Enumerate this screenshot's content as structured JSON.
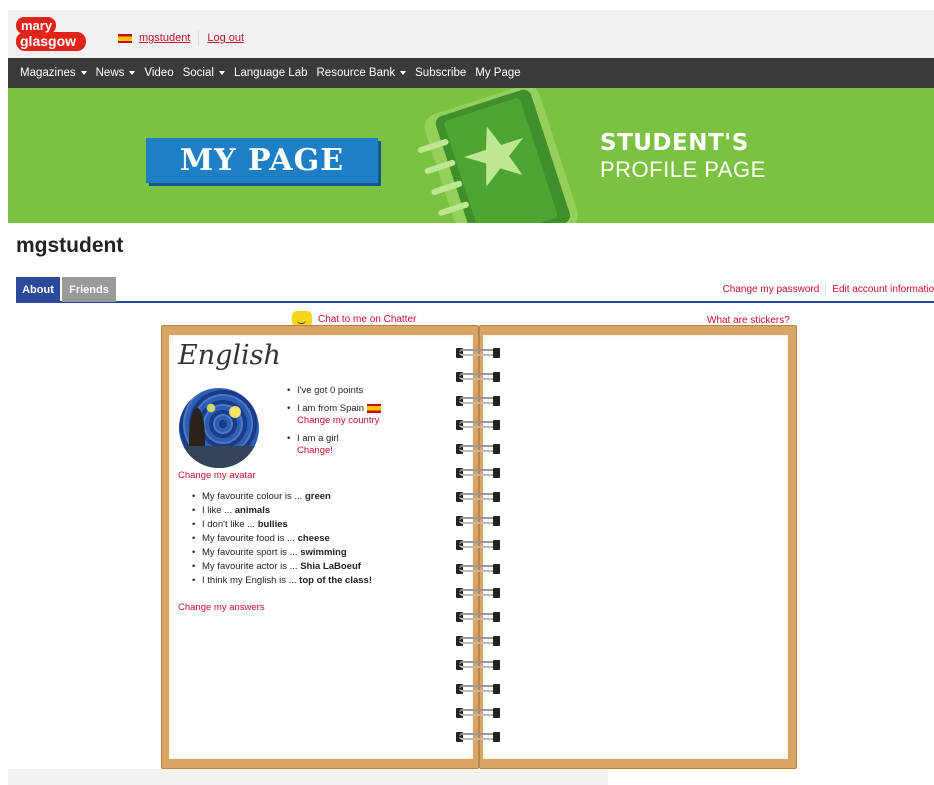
{
  "header": {
    "user_name": "mgstudent",
    "logout": "Log out"
  },
  "nav": {
    "items": [
      {
        "label": "Magazines",
        "dropdown": true
      },
      {
        "label": "News",
        "dropdown": true
      },
      {
        "label": "Video",
        "dropdown": false
      },
      {
        "label": "Social",
        "dropdown": true
      },
      {
        "label": "Language Lab",
        "dropdown": false
      },
      {
        "label": "Resource Bank",
        "dropdown": true
      },
      {
        "label": "Subscribe",
        "dropdown": false
      },
      {
        "label": "My Page",
        "dropdown": false
      }
    ]
  },
  "banner": {
    "badge": "MY PAGE",
    "title_line1": "STUDENT'S",
    "title_line2": "PROFILE PAGE"
  },
  "page_title": "mgstudent",
  "tabs": {
    "about": "About",
    "friends": "Friends",
    "change_password": "Change my password",
    "edit_account": "Edit account informatio"
  },
  "notebook": {
    "chatter_link": "Chat to me on Chatter",
    "stickers_link": "What are stickers?",
    "subject": "English",
    "points": "I've got 0 points",
    "from": "I am from Spain",
    "change_country": "Change my country",
    "gender": "I am a girl",
    "change_gender": "Change!",
    "change_avatar": "Change my avatar",
    "answers": [
      {
        "prefix": "My favourite colour is ... ",
        "value": "green"
      },
      {
        "prefix": "I like ... ",
        "value": "animals"
      },
      {
        "prefix": "I don't like ... ",
        "value": "bullies"
      },
      {
        "prefix": "My favourite food is ... ",
        "value": "cheese"
      },
      {
        "prefix": "My favourite sport is ... ",
        "value": "swimming"
      },
      {
        "prefix": "My favourite actor is ... ",
        "value": "Shia LaBoeuf"
      },
      {
        "prefix": "I think my English is ... ",
        "value": "top of the class!"
      }
    ],
    "change_answers": "Change my answers"
  },
  "colors": {
    "banner_green": "#7cc242",
    "badge_blue": "#1f7fc4",
    "link_red": "#c8102e",
    "tab_blue": "#2c4a9a",
    "nav_dark": "#3a3a3a"
  }
}
